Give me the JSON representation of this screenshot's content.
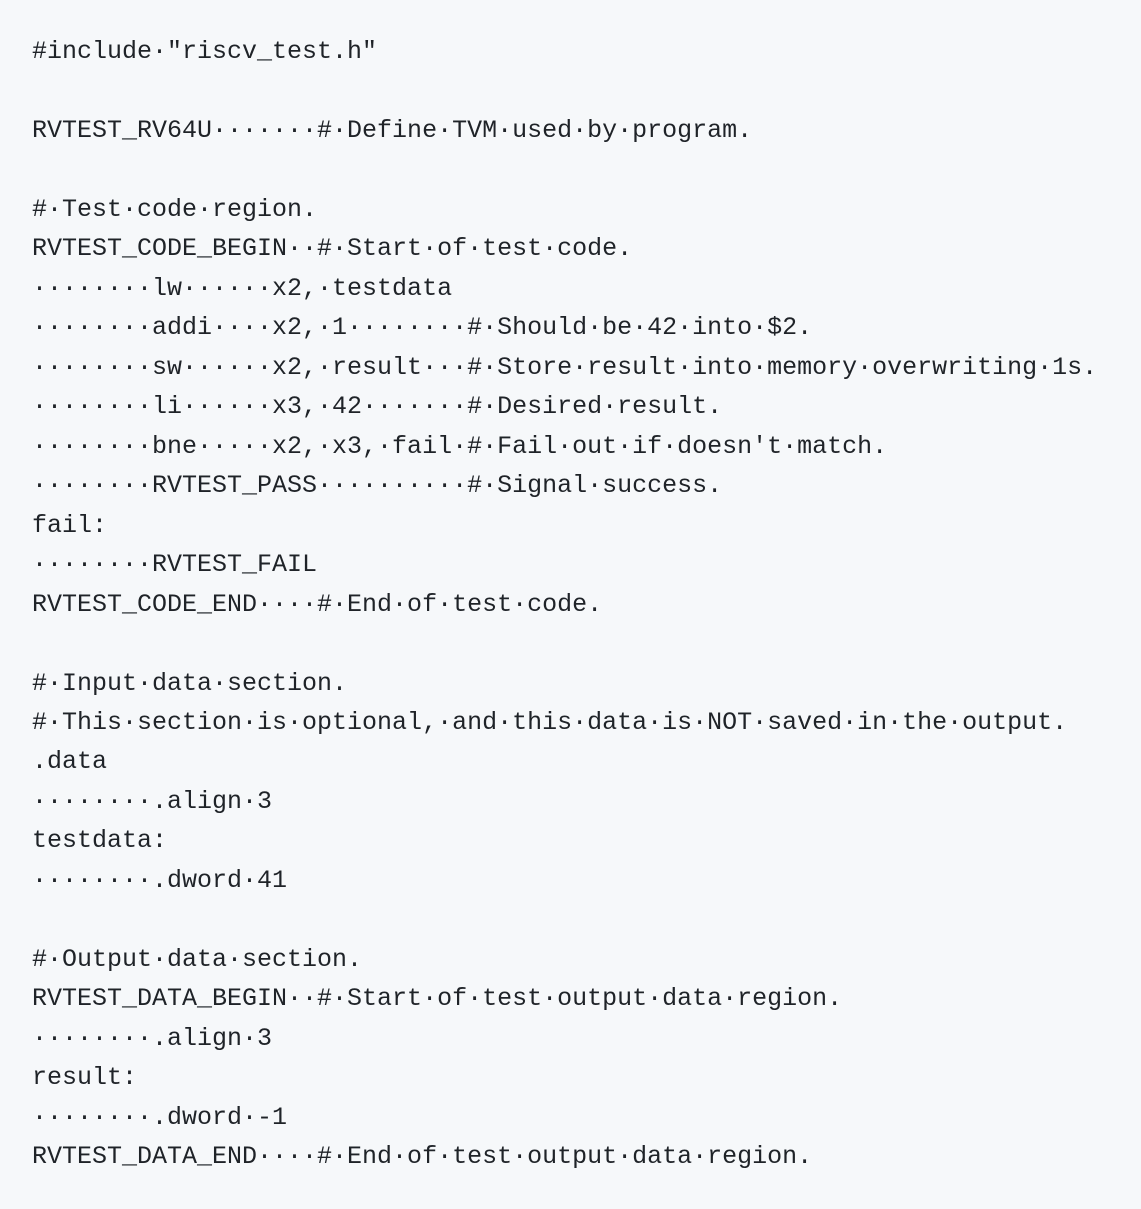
{
  "code": {
    "lines": [
      "#include·\"riscv_test.h\"",
      "",
      "RVTEST_RV64U·······#·Define·TVM·used·by·program.",
      "",
      "#·Test·code·region.",
      "RVTEST_CODE_BEGIN··#·Start·of·test·code.",
      "········lw······x2,·testdata",
      "········addi····x2,·1········#·Should·be·42·into·$2.",
      "········sw······x2,·result···#·Store·result·into·memory·overwriting·1s.",
      "········li······x3,·42·······#·Desired·result.",
      "········bne·····x2,·x3,·fail·#·Fail·out·if·doesn't·match.",
      "········RVTEST_PASS··········#·Signal·success.",
      "fail:",
      "········RVTEST_FAIL",
      "RVTEST_CODE_END····#·End·of·test·code.",
      "",
      "#·Input·data·section.",
      "#·This·section·is·optional,·and·this·data·is·NOT·saved·in·the·output.",
      ".data",
      "········.align·3",
      "testdata:",
      "········.dword·41",
      "",
      "#·Output·data·section.",
      "RVTEST_DATA_BEGIN··#·Start·of·test·output·data·region.",
      "········.align·3",
      "result:",
      "········.dword·-1",
      "RVTEST_DATA_END····#·End·of·test·output·data·region."
    ]
  }
}
